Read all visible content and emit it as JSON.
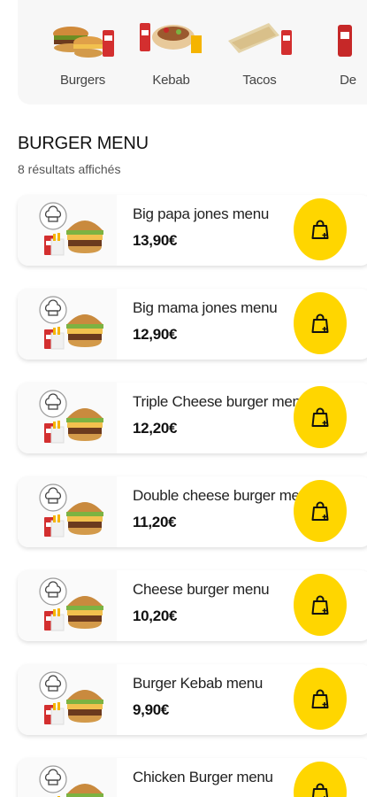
{
  "categories": [
    {
      "label": "Burgers",
      "icon": "burger-menu-photo"
    },
    {
      "label": "Kebab",
      "icon": "kebab-menu-photo"
    },
    {
      "label": "Tacos",
      "icon": "tacos-menu-photo"
    },
    {
      "label": "De",
      "icon": "dessert-photo"
    }
  ],
  "section": {
    "title": "BURGER MENU",
    "count": "8 résultats affichés"
  },
  "products": [
    {
      "name": "Big papa jones menu",
      "price": "13,90€"
    },
    {
      "name": "Big mama jones menu",
      "price": "12,90€"
    },
    {
      "name": "Triple Cheese burger menu",
      "price": "12,20€"
    },
    {
      "name": "Double cheese burger menu",
      "price": "11,20€"
    },
    {
      "name": "Cheese burger menu",
      "price": "10,20€"
    },
    {
      "name": "Burger Kebab menu",
      "price": "9,90€"
    },
    {
      "name": "Chicken Burger menu",
      "price": ""
    }
  ],
  "colors": {
    "accent": "#ffd600",
    "background": "#ffffff",
    "strip": "#f7f7f7"
  }
}
